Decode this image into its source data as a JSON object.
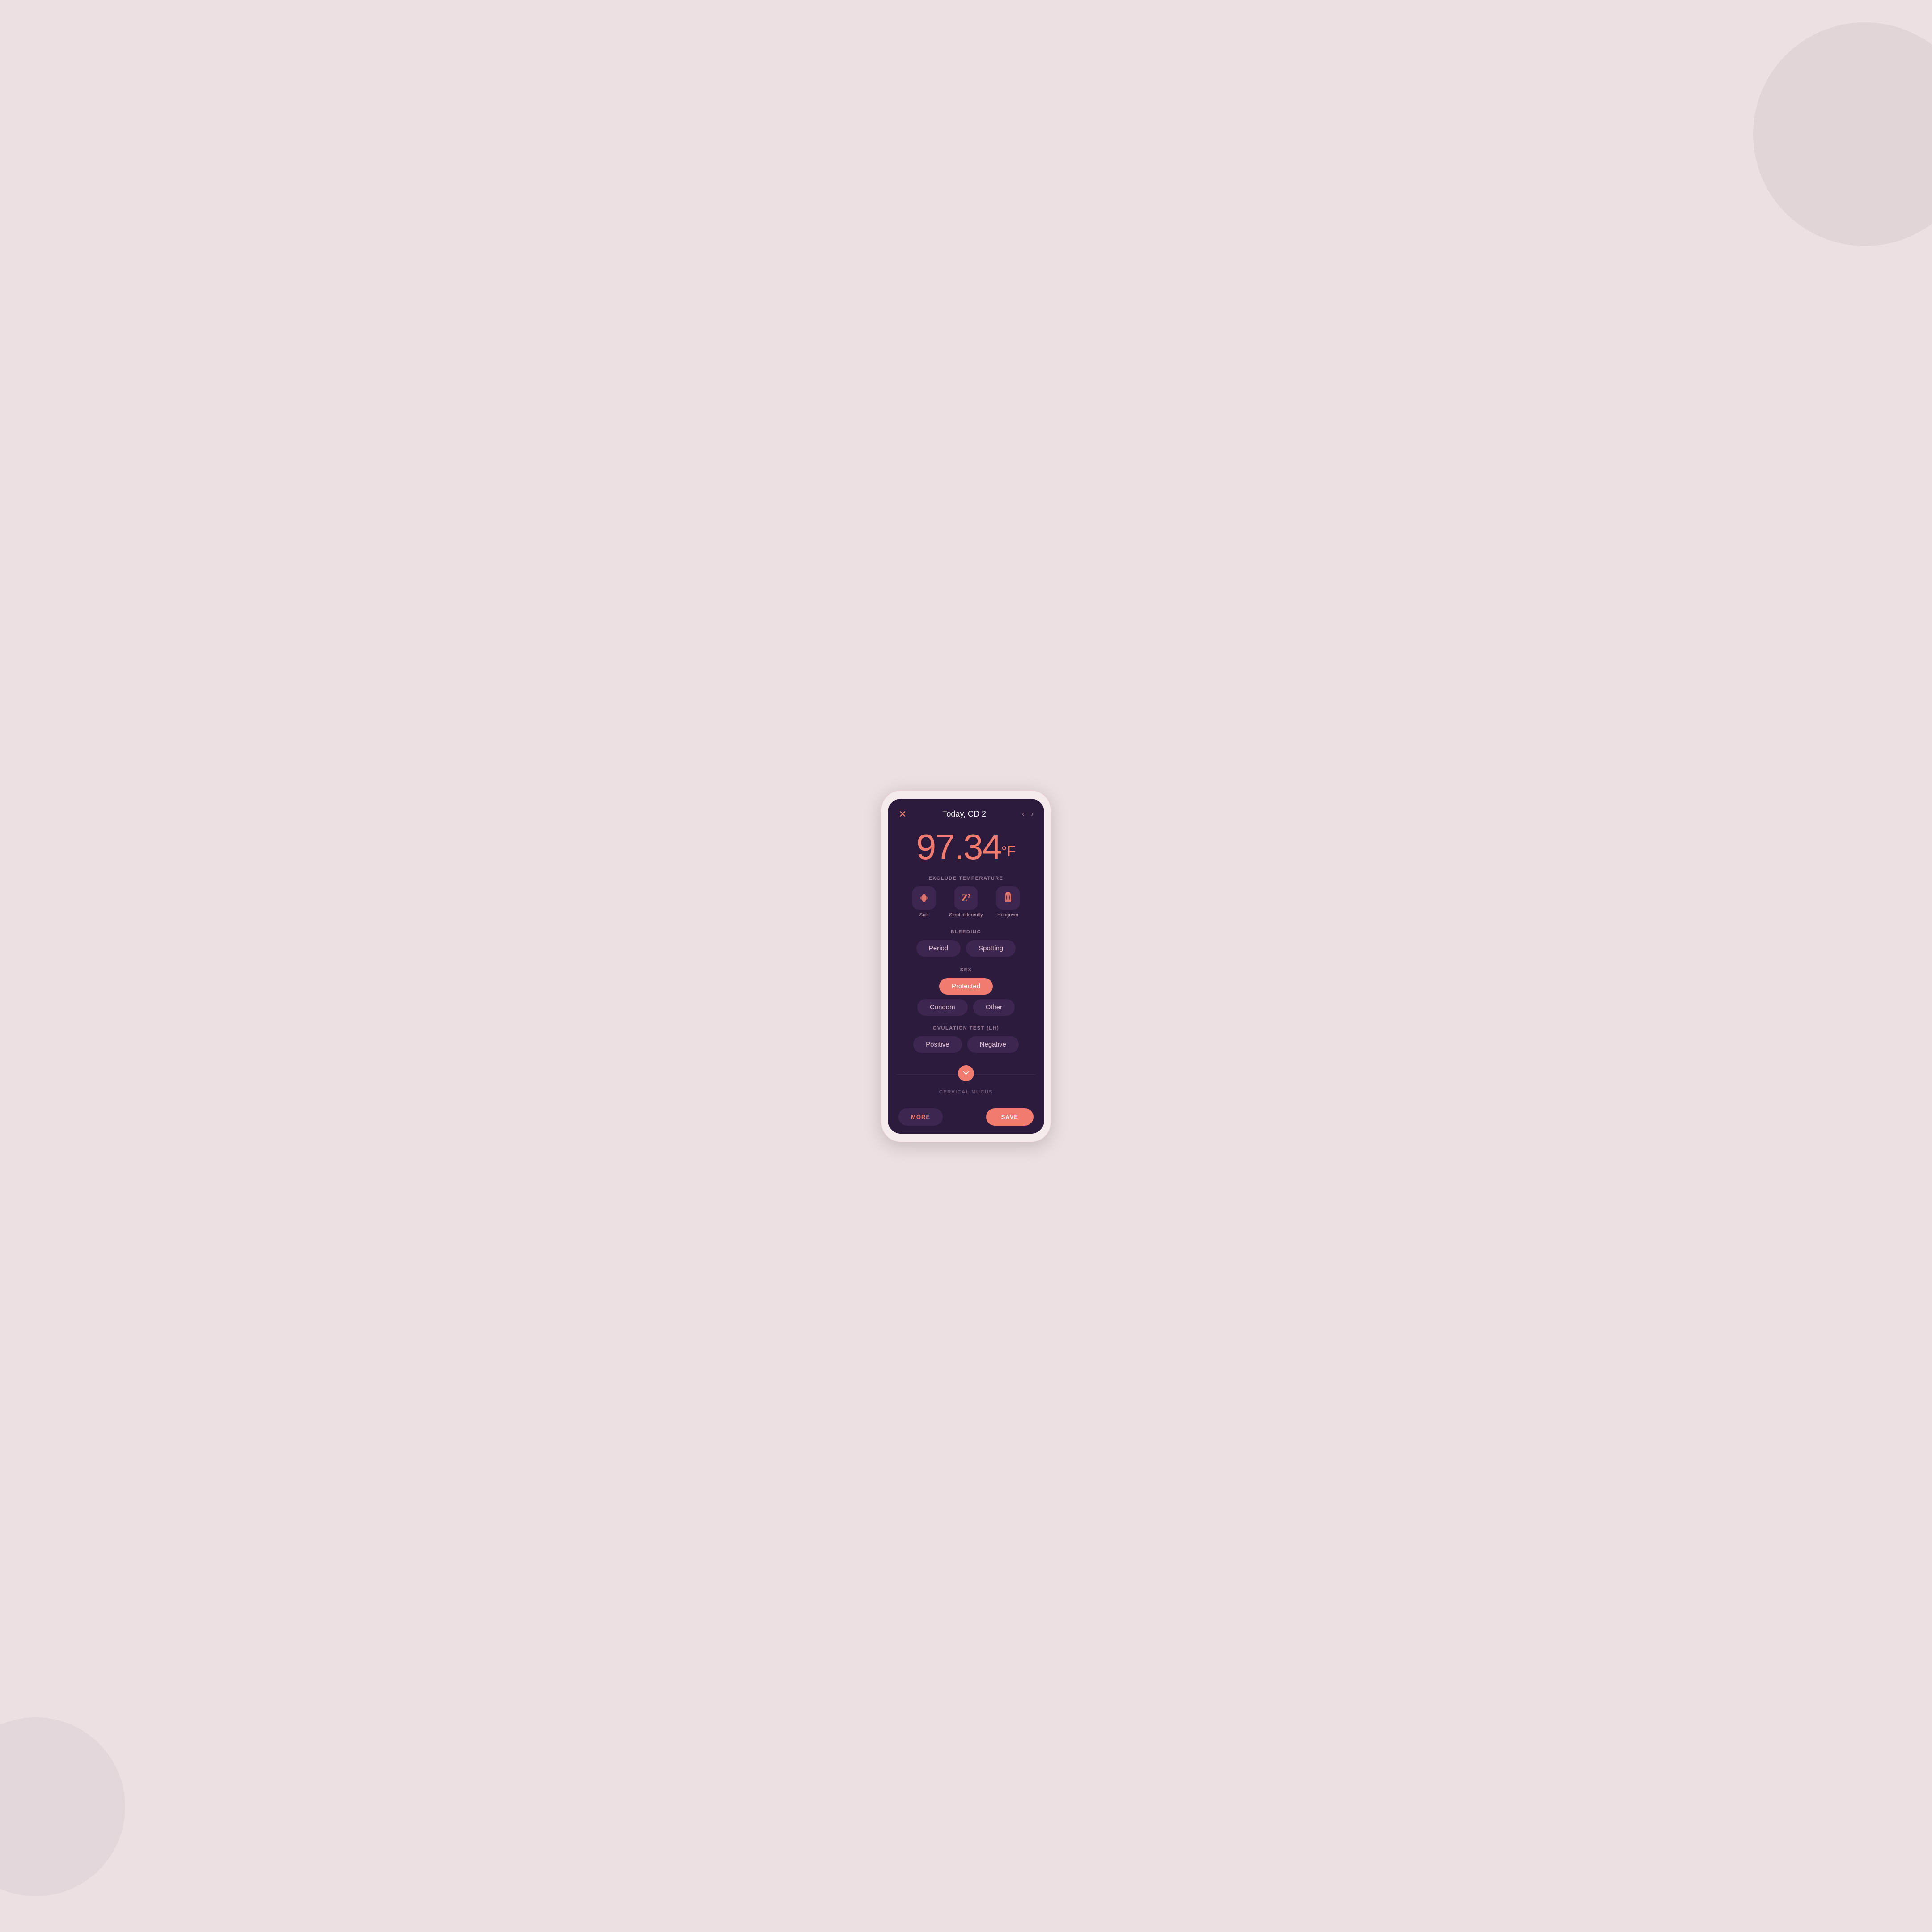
{
  "background": {
    "color": "#ede0e3"
  },
  "header": {
    "close_icon": "✕",
    "title": "Today, CD 2",
    "nav_left": "‹",
    "nav_right": "›"
  },
  "temperature": {
    "value": "97.34",
    "unit": "°F"
  },
  "exclude_temperature": {
    "label": "EXCLUDE TEMPERATURE",
    "options": [
      {
        "id": "sick",
        "icon": "💊",
        "label": "Sick"
      },
      {
        "id": "slept-differently",
        "icon": "💤",
        "label": "Slept differently"
      },
      {
        "id": "hungover",
        "icon": "🍺",
        "label": "Hungover"
      }
    ]
  },
  "bleeding": {
    "label": "BLEEDING",
    "options": [
      {
        "id": "period",
        "label": "Period",
        "active": false
      },
      {
        "id": "spotting",
        "label": "Spotting",
        "active": false
      }
    ]
  },
  "sex": {
    "label": "SEX",
    "protected_label": "Protected",
    "options": [
      {
        "id": "condom",
        "label": "Condom",
        "active": false
      },
      {
        "id": "other",
        "label": "Other",
        "active": false
      }
    ]
  },
  "ovulation_test": {
    "label": "OVULATION TEST (LH)",
    "options": [
      {
        "id": "positive",
        "label": "Positive",
        "active": false
      },
      {
        "id": "negative",
        "label": "Negative",
        "active": false
      }
    ]
  },
  "cervical_mucus": {
    "label": "CERVICAL MUCUS"
  },
  "footer": {
    "more_label": "MORE",
    "save_label": "SAVE"
  }
}
